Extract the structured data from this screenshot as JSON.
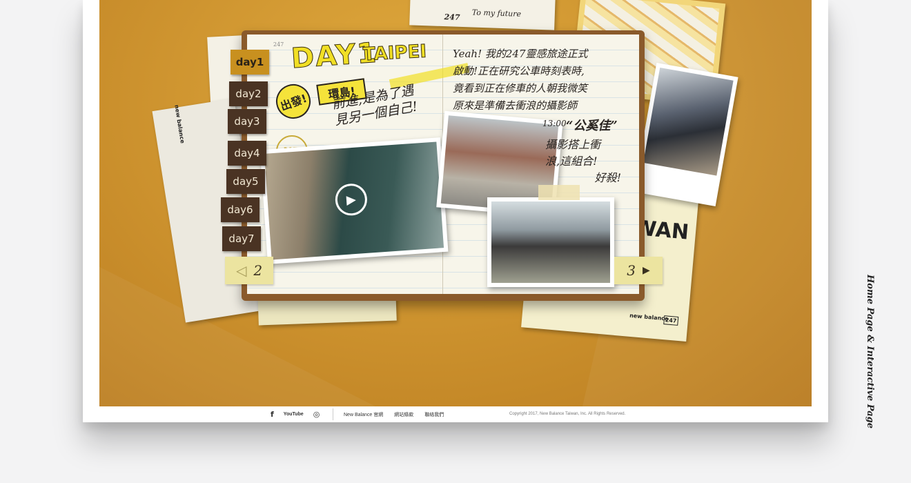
{
  "notebook": {
    "title_day": "DAY1",
    "title_city": "TAIPEI",
    "stamp_depart": "出發!",
    "stamp_island": "環島!",
    "note_left": "前進,是為了遇見另一個自己!",
    "note_right_1": "Yeah! 我的247靈感旅途正式",
    "note_right_2": "啟動!正在研究公車時刻表時,",
    "note_right_3": "竟看到正在修車的人朝我微笑",
    "note_right_4": "原來是準備去衝浪的攝影師",
    "note_time": "13:00",
    "note_name": "“公奚佳”",
    "note_right_5": "攝影搭上衝",
    "note_right_6": "浪,這組合!",
    "note_right_7": "好殺!",
    "page_tag": "247",
    "logo": "NB"
  },
  "day_tabs": [
    {
      "label": "day1",
      "active": true
    },
    {
      "label": "day2",
      "active": false
    },
    {
      "label": "day3",
      "active": false
    },
    {
      "label": "day4",
      "active": false
    },
    {
      "label": "day5",
      "active": false
    },
    {
      "label": "day6",
      "active": false
    },
    {
      "label": "day7",
      "active": false
    }
  ],
  "pager": {
    "prev_page": "2",
    "next_page": "3",
    "prev_icon": "◁",
    "next_icon": "▶"
  },
  "video": {
    "play_icon": "▶"
  },
  "decor": {
    "note_top": "To my future",
    "tag_247": "247",
    "poster_word": "WAN",
    "brand_nb": "new balance",
    "brand_247": "247"
  },
  "footer": {
    "social_icons": [
      "facebook-icon",
      "youtube-icon",
      "instagram-icon"
    ],
    "facebook_glyph": "f",
    "youtube_glyph": "YouTube",
    "instagram_glyph": "◎",
    "links": [
      "New Balance 官網",
      "網站條款",
      "聯絡我們"
    ],
    "copyright": "Copyright 2017, New Balance Taiwan, Inc. All Rights Reserved."
  },
  "side_label": "Home Page & Interactive Page",
  "colors": {
    "accent": "#f1df25",
    "bg": "#cf9530",
    "tab": "#4a3323"
  }
}
